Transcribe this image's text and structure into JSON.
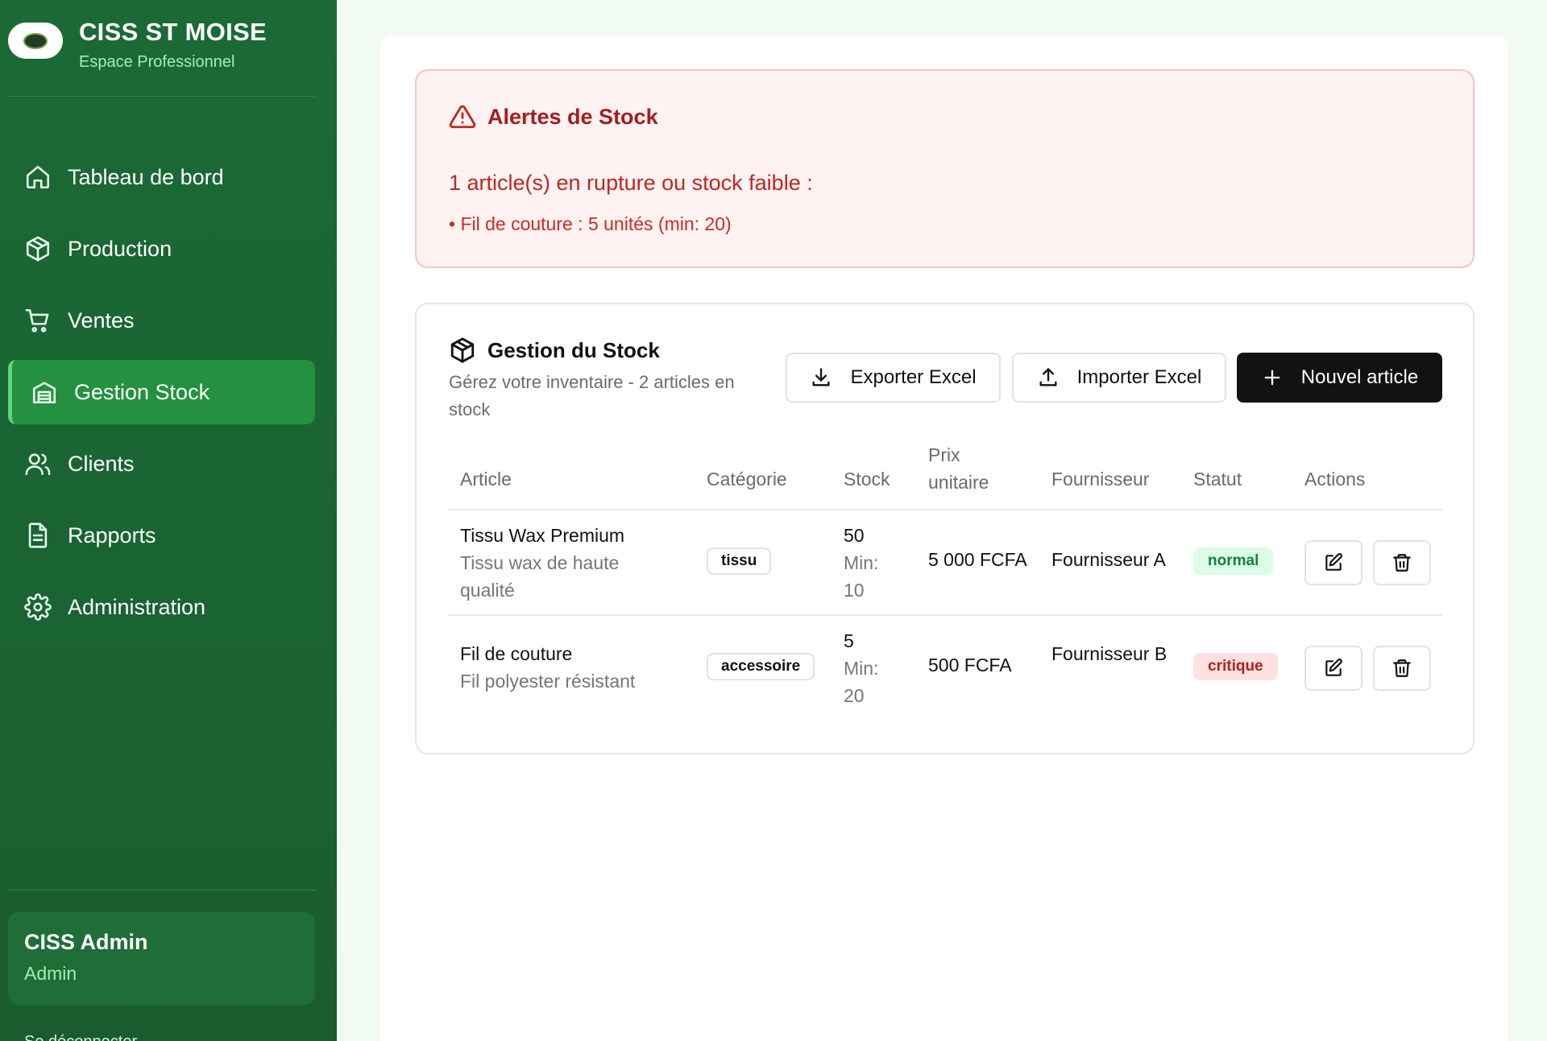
{
  "brand": {
    "title": "CISS ST MOISE",
    "subtitle": "Espace Professionnel"
  },
  "sidebar": {
    "items": [
      {
        "label": "Tableau de bord",
        "icon": "home-icon"
      },
      {
        "label": "Production",
        "icon": "box-icon"
      },
      {
        "label": "Ventes",
        "icon": "cart-icon"
      },
      {
        "label": "Gestion Stock",
        "icon": "warehouse-icon",
        "active": true
      },
      {
        "label": "Clients",
        "icon": "users-icon"
      },
      {
        "label": "Rapports",
        "icon": "file-icon"
      },
      {
        "label": "Administration",
        "icon": "gear-icon"
      }
    ]
  },
  "user": {
    "name": "CISS Admin",
    "role": "Admin"
  },
  "logout_label": "Se déconnecter",
  "alert": {
    "title": "Alertes de Stock",
    "message": "1 article(s) en rupture ou stock faible :",
    "items": [
      "• Fil de couture : 5 unités (min: 20)"
    ]
  },
  "stock": {
    "title": "Gestion du Stock",
    "subtitle": "Gérez votre inventaire - 2 articles en stock",
    "buttons": {
      "export": "Exporter Excel",
      "import": "Importer Excel",
      "new": "Nouvel article"
    },
    "columns": [
      "Article",
      "Catégorie",
      "Stock",
      "Prix unitaire",
      "Fournisseur",
      "Statut",
      "Actions"
    ],
    "rows": [
      {
        "name": "Tissu Wax Premium",
        "description": "Tissu wax de haute qualité",
        "category": "tissu",
        "stock": "50",
        "min": "Min: 10",
        "price": "5 000 FCFA",
        "supplier": "Fournisseur A",
        "status": "normal"
      },
      {
        "name": "Fil de couture",
        "description": "Fil polyester résistant",
        "category": "accessoire",
        "stock": "5",
        "min": "Min: 20",
        "price": "500 FCFA",
        "supplier": "Fournisseur B",
        "status": "critique"
      }
    ]
  },
  "colors": {
    "sidebar": "#1b6a35",
    "active": "#23913f",
    "accent": "#9ff0b4",
    "alert": "#c0271f"
  }
}
